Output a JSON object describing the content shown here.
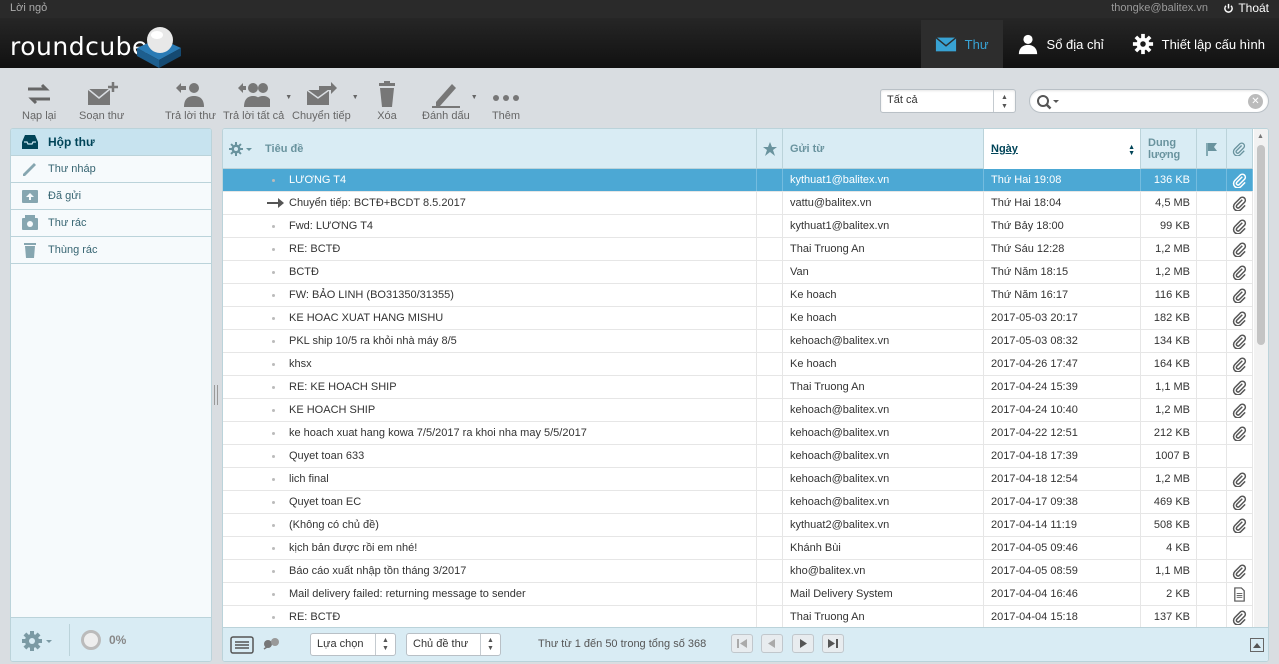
{
  "topline": {
    "about": "Lời ngỏ",
    "username": "thongke@balitex.vn",
    "logout": "Thoát"
  },
  "header": {
    "logo": "roundcube",
    "tasks": [
      {
        "label": "Thư",
        "icon": "mail-icon"
      },
      {
        "label": "Sổ địa chỉ",
        "icon": "contacts-icon"
      },
      {
        "label": "Thiết lập cấu hình",
        "icon": "settings-icon"
      }
    ]
  },
  "toolbar": {
    "refresh": "Nạp lại",
    "compose": "Soạn thư",
    "reply": "Trả lời thư",
    "reply_all": "Trả lời tất cả",
    "forward": "Chuyển tiếp",
    "delete": "Xóa",
    "mark": "Đánh dấu",
    "more": "Thêm"
  },
  "search": {
    "filter": "Tất cả",
    "placeholder": ""
  },
  "folders": {
    "items": [
      {
        "label": "Hộp thư",
        "icon": "inbox-icon"
      },
      {
        "label": "Thư nháp",
        "icon": "drafts-icon"
      },
      {
        "label": "Đã gửi",
        "icon": "sent-icon"
      },
      {
        "label": "Thư rác",
        "icon": "junk-icon"
      },
      {
        "label": "Thùng rác",
        "icon": "trash-icon"
      }
    ],
    "quota": "0%"
  },
  "list": {
    "columns": {
      "subject": "Tiêu đề",
      "from": "Gửi từ",
      "date": "Ngày",
      "size": "Dung lượng"
    },
    "rows": [
      {
        "subject": "LƯƠNG T4",
        "from": "kythuat1@balitex.vn",
        "date": "Thứ Hai 19:08",
        "size": "136 KB",
        "attachment": "paperclip",
        "forwarded": false
      },
      {
        "subject": "Chuyển tiếp: BCTĐ+BCDT 8.5.2017",
        "from": "vattu@balitex.vn",
        "date": "Thứ Hai 18:04",
        "size": "4,5 MB",
        "attachment": "paperclip",
        "forwarded": true
      },
      {
        "subject": "Fwd: LƯƠNG T4",
        "from": "kythuat1@balitex.vn",
        "date": "Thứ Bảy 18:00",
        "size": "99 KB",
        "attachment": "paperclip",
        "forwarded": false
      },
      {
        "subject": "RE: BCTĐ",
        "from": "Thai Truong An",
        "date": "Thứ Sáu 12:28",
        "size": "1,2 MB",
        "attachment": "paperclip",
        "forwarded": false
      },
      {
        "subject": "BCTĐ",
        "from": "Van",
        "date": "Thứ Năm 18:15",
        "size": "1,2 MB",
        "attachment": "paperclip",
        "forwarded": false
      },
      {
        "subject": "FW: BẢO LINH (BO31350/31355)",
        "from": "Ke hoach",
        "date": "Thứ Năm 16:17",
        "size": "116 KB",
        "attachment": "paperclip",
        "forwarded": false
      },
      {
        "subject": "KE HOAC XUAT HANG MISHU",
        "from": "Ke hoach",
        "date": "2017-05-03 20:17",
        "size": "182 KB",
        "attachment": "paperclip",
        "forwarded": false
      },
      {
        "subject": "PKL ship 10/5 ra khỏi nhà máy 8/5",
        "from": "kehoach@balitex.vn",
        "date": "2017-05-03 08:32",
        "size": "134 KB",
        "attachment": "paperclip",
        "forwarded": false
      },
      {
        "subject": "khsx",
        "from": "Ke hoach",
        "date": "2017-04-26 17:47",
        "size": "164 KB",
        "attachment": "paperclip",
        "forwarded": false
      },
      {
        "subject": "RE: KE HOACH SHIP",
        "from": "Thai Truong An",
        "date": "2017-04-24 15:39",
        "size": "1,1 MB",
        "attachment": "paperclip",
        "forwarded": false
      },
      {
        "subject": "KE HOACH SHIP",
        "from": "kehoach@balitex.vn",
        "date": "2017-04-24 10:40",
        "size": "1,2 MB",
        "attachment": "paperclip",
        "forwarded": false
      },
      {
        "subject": "ke hoach xuat hang kowa 7/5/2017 ra khoi nha may 5/5/2017",
        "from": "kehoach@balitex.vn",
        "date": "2017-04-22 12:51",
        "size": "212 KB",
        "attachment": "paperclip",
        "forwarded": false
      },
      {
        "subject": "Quyet toan 633",
        "from": "kehoach@balitex.vn",
        "date": "2017-04-18 17:39",
        "size": "1007 B",
        "attachment": "none",
        "forwarded": false
      },
      {
        "subject": "lich final",
        "from": "kehoach@balitex.vn",
        "date": "2017-04-18 12:54",
        "size": "1,2 MB",
        "attachment": "paperclip",
        "forwarded": false
      },
      {
        "subject": "Quyet toan EC",
        "from": "kehoach@balitex.vn",
        "date": "2017-04-17 09:38",
        "size": "469 KB",
        "attachment": "paperclip",
        "forwarded": false
      },
      {
        "subject": "(Không có chủ đề)",
        "from": "kythuat2@balitex.vn",
        "date": "2017-04-14 11:19",
        "size": "508 KB",
        "attachment": "paperclip",
        "forwarded": false
      },
      {
        "subject": "kịch bản được rồi em nhé!",
        "from": "Khánh Bùi",
        "date": "2017-04-05 09:46",
        "size": "4 KB",
        "attachment": "none",
        "forwarded": false
      },
      {
        "subject": "Báo cáo xuất nhập tồn tháng 3/2017",
        "from": "kho@balitex.vn",
        "date": "2017-04-05 08:59",
        "size": "1,1 MB",
        "attachment": "paperclip",
        "forwarded": false
      },
      {
        "subject": "Mail delivery failed: returning message to sender",
        "from": "Mail Delivery System",
        "date": "2017-04-04 16:46",
        "size": "2 KB",
        "attachment": "report",
        "forwarded": false
      },
      {
        "subject": "RE: BCTĐ",
        "from": "Thai Truong An",
        "date": "2017-04-04 15:18",
        "size": "137 KB",
        "attachment": "paperclip",
        "forwarded": false
      }
    ]
  },
  "footer": {
    "select": "Lựa chọn",
    "threads": "Chủ đề thư",
    "count": "Thư từ 1 đến 50 trong tổng số 368"
  },
  "colors": {
    "accent": "#38a2d3",
    "selected_row": "#4ca8d4",
    "panel_border": "#bbd3da"
  }
}
